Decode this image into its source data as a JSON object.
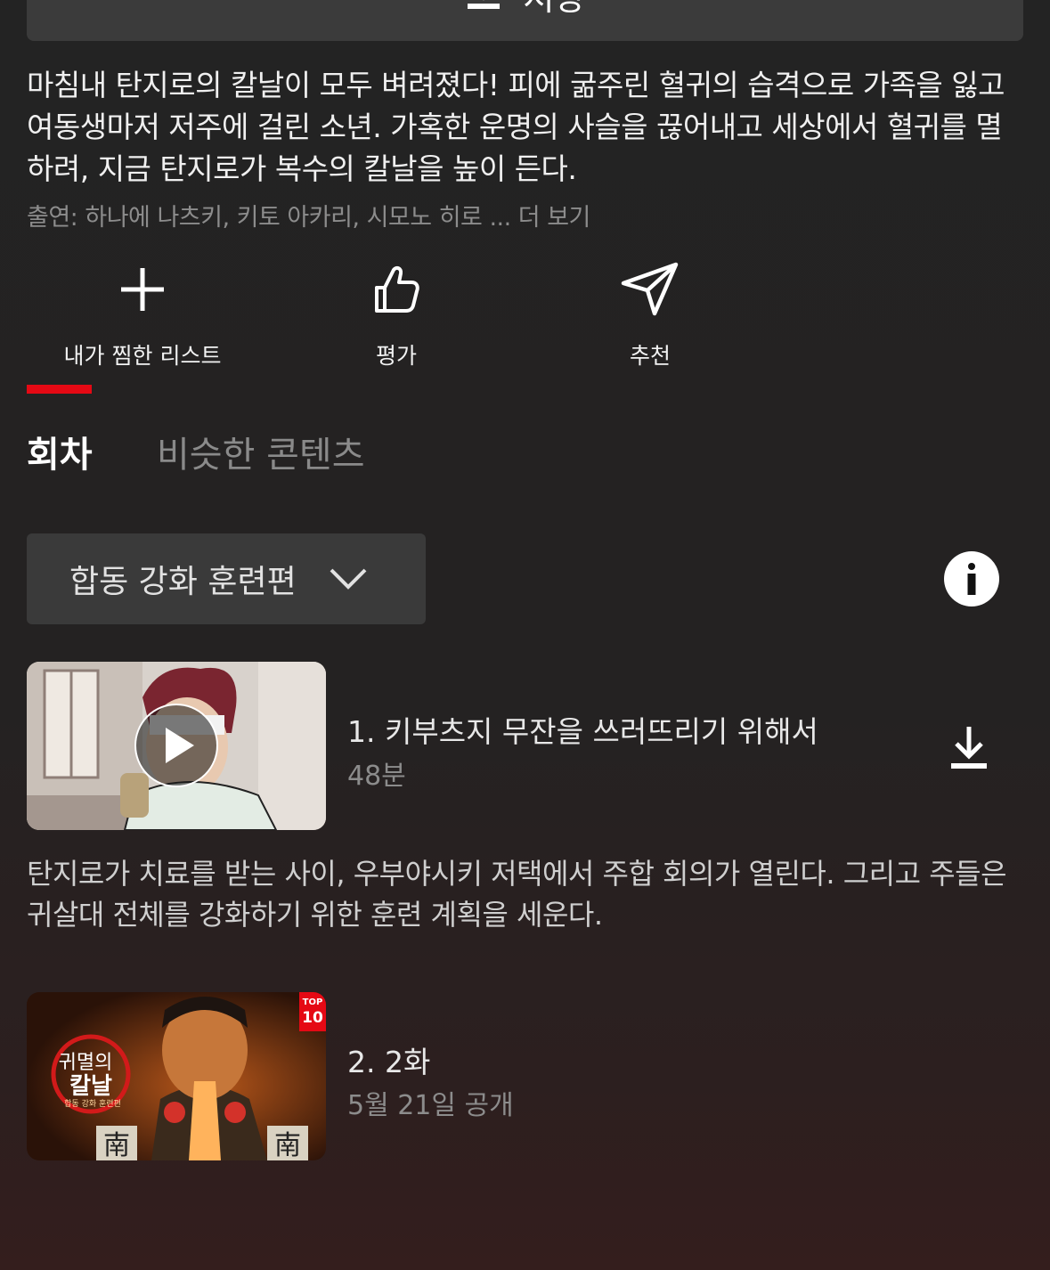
{
  "top_button": {
    "label": "저장",
    "icon": "download-icon"
  },
  "synopsis": "마침내 탄지로의 칼날이 모두 벼려졌다! 피에 굶주린 혈귀의 습격으로 가족을 잃고 여동생마저 저주에 걸린 소년. 가혹한 운명의 사슬을 끊어내고 세상에서 혈귀를 멸하려, 지금 탄지로가 복수의 칼날을 높이 든다.",
  "cast": "출연: 하나에 나츠키, 키토 아카리, 시모노 히로 ... 더 보기",
  "actions": [
    {
      "label": "내가 찜한 리스트",
      "icon": "plus-icon"
    },
    {
      "label": "평가",
      "icon": "thumbs-up-icon"
    },
    {
      "label": "추천",
      "icon": "send-icon"
    }
  ],
  "tabs": [
    {
      "label": "회차",
      "active": true
    },
    {
      "label": "비슷한 콘텐츠",
      "active": false
    }
  ],
  "season_selector": {
    "label": "합동 강화 훈련편"
  },
  "episodes": [
    {
      "title": "1. 키부츠지 무잔을 쓰러뜨리기 위해서",
      "subtitle": "48분",
      "description": "탄지로가 치료를 받는 사이, 우부야시키 저택에서 주합 회의가 열린다. 그리고 주들은 귀살대 전체를 강화하기 위한 훈련 계획을 세운다."
    },
    {
      "title": "2. 2화",
      "subtitle": "5월 21일 공개",
      "badge_top": "TOP",
      "badge_num": "10",
      "logo_line1": "귀멸의",
      "logo_line2": "칼날",
      "logo_line3": "합동 강화 훈련편",
      "emblem": "南"
    }
  ],
  "colors": {
    "accent": "#e50914",
    "background": "#232323"
  }
}
